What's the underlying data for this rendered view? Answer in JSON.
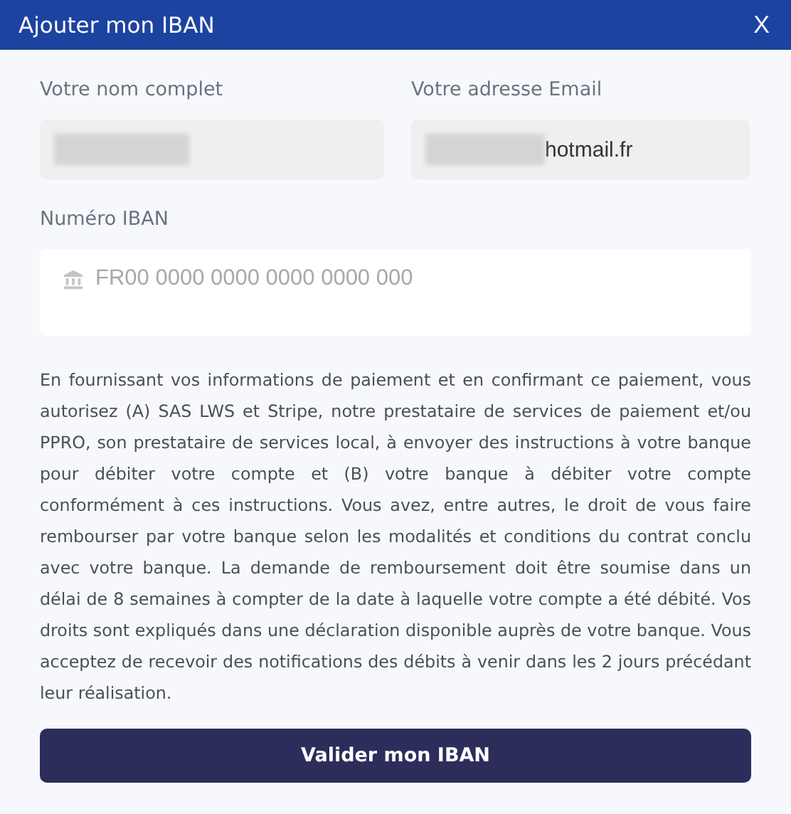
{
  "dialog": {
    "title": "Ajouter mon IBAN",
    "close": "X"
  },
  "fields": [
    {
      "label": "Votre nom complet",
      "redacted": true
    },
    {
      "label": "Votre adresse Email",
      "redacted": true,
      "value": "hotmail.fr"
    }
  ],
  "iban": {
    "label": "Numéro IBAN",
    "placeholder": "FR00 0000 0000 0000 0000 000"
  },
  "mandate_text": "En fournissant vos informations de paiement et en confirmant ce paiement, vous autorisez (A) SAS LWS et Stripe, notre prestataire de services de paiement et/ou PPRO, son prestataire de services local, à envoyer des instructions à votre banque pour débiter votre compte et (B) votre banque à débiter votre compte conformément à ces instructions. Vous avez, entre autres, le droit de vous faire rembourser par votre banque selon les modalités et conditions du contrat conclu avec votre banque. La demande de remboursement doit être soumise dans un délai de 8 semaines à compter de la date à laquelle votre compte a été débité. Vos droits sont expliqués dans une déclaration disponible auprès de votre banque. Vous acceptez de recevoir des notifications des débits à venir dans les 2 jours précédant leur réalisation.",
  "submit": "Valider mon IBAN"
}
